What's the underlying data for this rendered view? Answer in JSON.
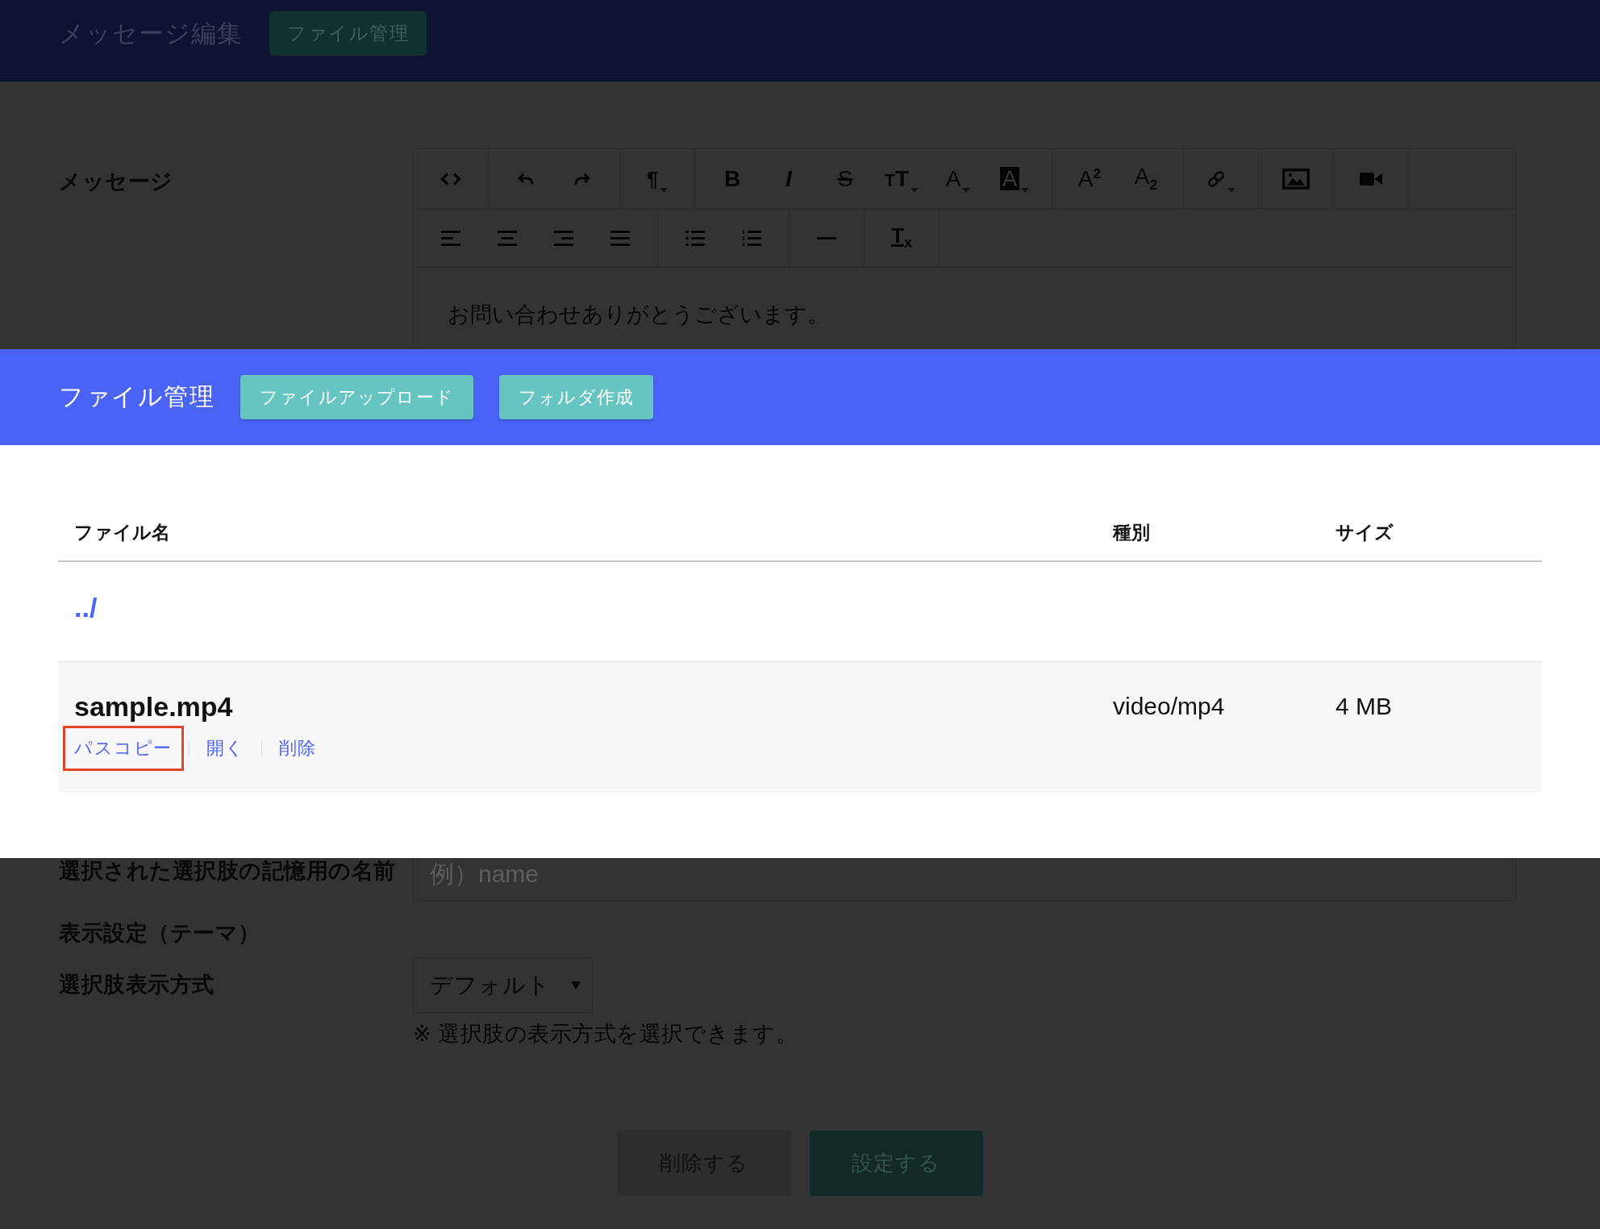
{
  "header": {
    "title": "メッセージ編集",
    "button": "ファイル管理"
  },
  "message": {
    "label": "メッセージ",
    "toolbar": [
      [
        [
          {
            "kind": "code",
            "dropdown": false
          }
        ],
        [
          {
            "kind": "undo",
            "dropdown": false
          },
          {
            "kind": "redo",
            "dropdown": false
          }
        ],
        [
          {
            "kind": "paragraph_format",
            "text": "¶",
            "dropdown": true
          }
        ],
        [
          {
            "kind": "bold",
            "text": "B",
            "dropdown": false
          },
          {
            "kind": "italic",
            "text": "I",
            "dropdown": false
          },
          {
            "kind": "strikethrough",
            "text": "S",
            "dropdown": false
          },
          {
            "kind": "font_size",
            "text": "$_{T}$T",
            "dropdown": true
          },
          {
            "kind": "text_color",
            "text": "A",
            "dropdown": true
          },
          {
            "kind": "background_color",
            "text": "A",
            "dropdown": true
          }
        ],
        [
          {
            "kind": "superscript",
            "text": "A$^{2}$",
            "dropdown": false
          },
          {
            "kind": "subscript",
            "text": "A$_{2}$",
            "dropdown": false
          }
        ],
        [
          {
            "kind": "link",
            "dropdown": true
          }
        ],
        [
          {
            "kind": "image",
            "dropdown": false
          }
        ],
        [
          {
            "kind": "video",
            "dropdown": false
          }
        ]
      ],
      [
        [
          {
            "kind": "align_left",
            "dropdown": false
          },
          {
            "kind": "align_center",
            "dropdown": false
          },
          {
            "kind": "align_right",
            "dropdown": false
          },
          {
            "kind": "align_justify",
            "dropdown": false
          }
        ],
        [
          {
            "kind": "bullet_list",
            "dropdown": false
          },
          {
            "kind": "numbered_list",
            "dropdown": false
          }
        ],
        [
          {
            "kind": "horizontal_rule",
            "dropdown": false
          }
        ],
        [
          {
            "kind": "clear_formatting",
            "text": "T$_{x}$",
            "dropdown": false
          }
        ]
      ]
    ],
    "content": "お問い合わせありがとうございます。"
  },
  "file_manager": {
    "title": "ファイル管理",
    "buttons": [
      "ファイルアップロード",
      "フォルダ作成"
    ],
    "table": {
      "columns": [
        "ファイル名",
        "種別",
        "サイズ"
      ],
      "rows": [
        {
          "kind": "parent",
          "name": "../"
        },
        {
          "kind": "file",
          "name": "sample.mp4",
          "type": "video/mp4",
          "size": "4 MB",
          "actions": [
            {
              "label": "パスコピー",
              "highlighted": true
            },
            {
              "label": "開く",
              "highlighted": false
            },
            {
              "label": "削除",
              "highlighted": false
            }
          ]
        }
      ]
    }
  },
  "form": {
    "rows": [
      {
        "kind": "input",
        "label": "選択された選択肢の記憶用の名前",
        "placeholder": "例）name"
      },
      {
        "kind": "heading",
        "label": "表示設定（テーマ）"
      },
      {
        "kind": "select",
        "label": "選択肢表示方式",
        "value": "デフォルト",
        "hint": "※ 選択肢の表示方式を選択できます。"
      }
    ],
    "buttons": [
      {
        "kind": "delete",
        "label": "削除する"
      },
      {
        "kind": "submit",
        "label": "設定する"
      }
    ]
  }
}
